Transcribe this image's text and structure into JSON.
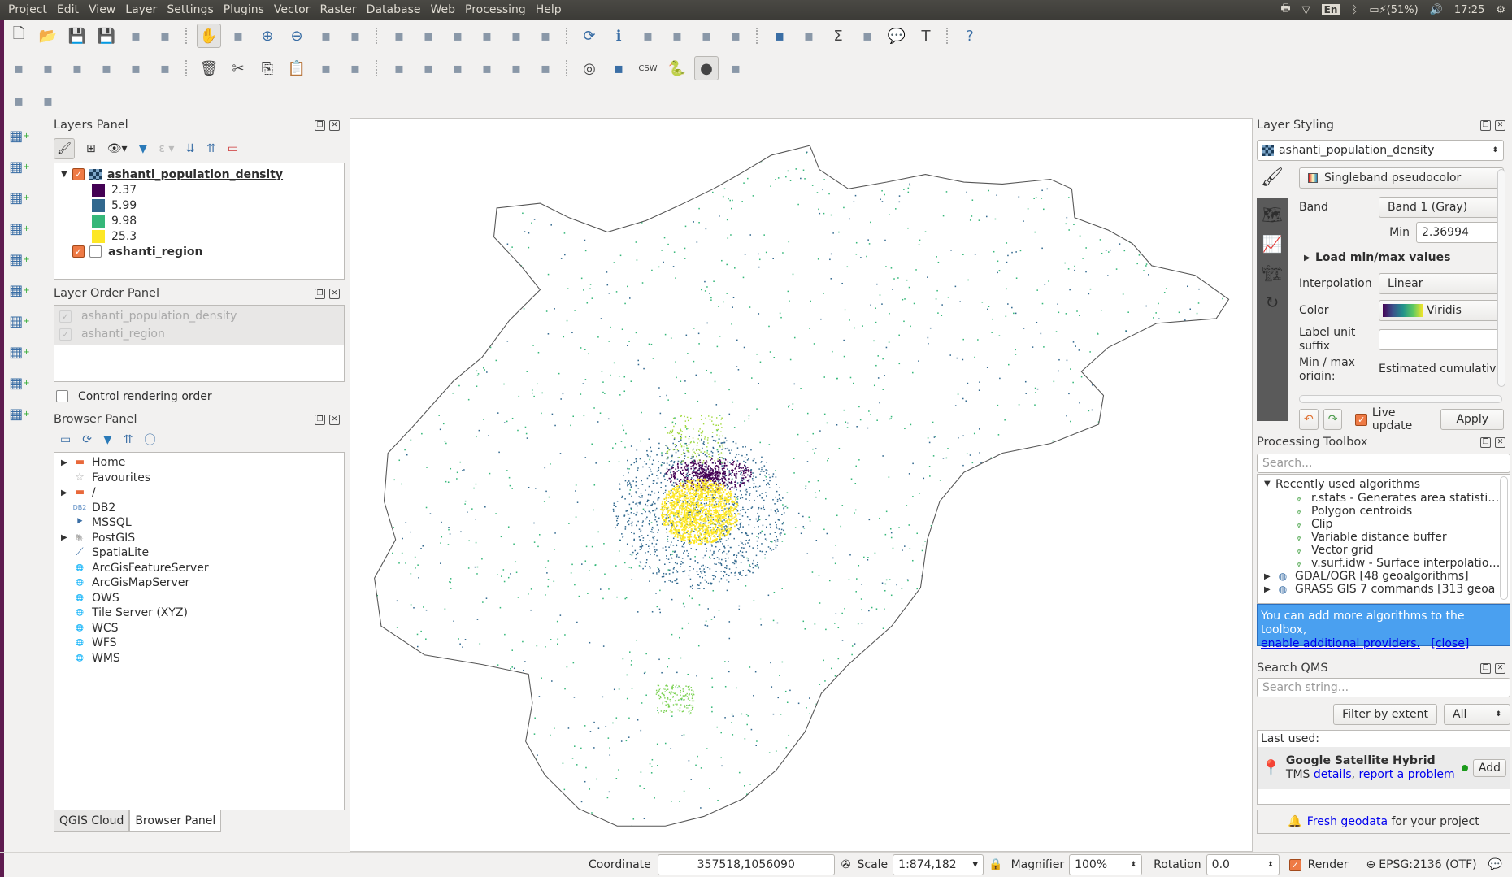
{
  "menubar": {
    "items": [
      "Project",
      "Edit",
      "View",
      "Layer",
      "Settings",
      "Plugins",
      "Vector",
      "Raster",
      "Database",
      "Web",
      "Processing",
      "Help"
    ],
    "tray": {
      "language": "En",
      "battery": "(51%)",
      "time": "17:25"
    }
  },
  "toolbars": {
    "row1": [
      "new-project",
      "open-project",
      "save-project",
      "save-as",
      "new-print-composer",
      "composer-manager",
      "pan",
      "pan-to-selection",
      "zoom-in",
      "zoom-out",
      "zoom-native",
      "zoom-full",
      "zoom-to-selection",
      "zoom-to-layer",
      "zoom-last",
      "zoom-next",
      "new-bookmark",
      "show-bookmarks",
      "refresh",
      "identify",
      "run-action",
      "select-features",
      "select-by-expression",
      "deselect",
      "open-attribute-table",
      "field-calculator",
      "statistical-summary",
      "measure",
      "map-tips",
      "text-annotation",
      "help"
    ],
    "row2": [
      "digitize",
      "toggle-editing",
      "save-edits",
      "add-feature",
      "vertex-tool",
      "move-feature",
      "delete-selected",
      "cut-features",
      "copy-features",
      "paste-features",
      "layer-labeling",
      "label-diagram",
      "pin-labels",
      "highlight-labels",
      "move-label",
      "rotate-label",
      "change-label",
      "label-properties",
      "offline-edit",
      "metasearch",
      "csw",
      "python-console",
      "qgis-cloud",
      "qms-plugin"
    ],
    "row3": [
      "select-tool",
      "geo-plugin"
    ]
  },
  "vertical_toolbar": [
    "add-vector-layer",
    "add-raster-layer",
    "add-spatialite-layer",
    "add-postgis-layer",
    "add-wms-layer",
    "add-wcs-layer",
    "add-wfs-layer",
    "add-delimited-text-layer",
    "new-shapefile-layer",
    "add-virtual-layer"
  ],
  "layers_panel": {
    "title": "Layers Panel",
    "layers": [
      {
        "name": "ashanti_population_density",
        "checked": true,
        "legend": [
          {
            "label": "2.37",
            "color": "#440154"
          },
          {
            "label": "5.99",
            "color": "#31688e"
          },
          {
            "label": "9.98",
            "color": "#35b779"
          },
          {
            "label": "25.3",
            "color": "#fde725"
          }
        ]
      },
      {
        "name": "ashanti_region",
        "checked": true
      }
    ]
  },
  "layer_order_panel": {
    "title": "Layer Order Panel",
    "items": [
      "ashanti_population_density",
      "ashanti_region"
    ],
    "control_label": "Control rendering order",
    "control_checked": false
  },
  "browser_panel": {
    "title": "Browser Panel",
    "items": [
      {
        "label": "Home",
        "icon": "folder-icon",
        "expandable": true
      },
      {
        "label": "Favourites",
        "icon": "star-icon",
        "expandable": false
      },
      {
        "label": "/",
        "icon": "folder-icon",
        "expandable": true
      },
      {
        "label": "DB2",
        "icon": "db2-icon",
        "expandable": false
      },
      {
        "label": "MSSQL",
        "icon": "mssql-icon",
        "expandable": false
      },
      {
        "label": "PostGIS",
        "icon": "postgis-icon",
        "expandable": true
      },
      {
        "label": "SpatiaLite",
        "icon": "feather-icon",
        "expandable": false
      },
      {
        "label": "ArcGisFeatureServer",
        "icon": "globe-icon",
        "expandable": false
      },
      {
        "label": "ArcGisMapServer",
        "icon": "globe-icon",
        "expandable": false
      },
      {
        "label": "OWS",
        "icon": "globe-icon",
        "expandable": false
      },
      {
        "label": "Tile Server (XYZ)",
        "icon": "globe-icon",
        "expandable": false
      },
      {
        "label": "WCS",
        "icon": "globe-icon",
        "expandable": false
      },
      {
        "label": "WFS",
        "icon": "globe-icon",
        "expandable": false
      },
      {
        "label": "WMS",
        "icon": "globe-icon",
        "expandable": false
      }
    ],
    "tabs": [
      "QGIS Cloud",
      "Browser Panel"
    ],
    "active_tab": "Browser Panel"
  },
  "layer_styling": {
    "title": "Layer Styling",
    "layer": "ashanti_population_density",
    "renderer": "Singleband pseudocolor",
    "band_label": "Band",
    "band": "Band 1 (Gray)",
    "min_label": "Min",
    "min": "2.36994",
    "load_minmax": "Load min/max values",
    "interpolation_label": "Interpolation",
    "interpolation": "Linear",
    "color_label": "Color",
    "color_ramp": "Viridis",
    "unit_label": "Label unit suffix",
    "unit_value": "",
    "origin_label": "Min / max origin:",
    "origin_value": "Estimated cumulative",
    "live_update": "Live update",
    "live_checked": true,
    "apply": "Apply"
  },
  "processing_toolbox": {
    "title": "Processing Toolbox",
    "search_placeholder": "Search...",
    "recent_label": "Recently used algorithms",
    "recent": [
      "r.stats - Generates area statisti…",
      "Polygon centroids",
      "Clip",
      "Variable distance buffer",
      "Vector grid",
      "v.surf.idw - Surface interpolatio…"
    ],
    "groups": [
      "GDAL/OGR [48 geoalgorithms]",
      "GRASS GIS 7 commands [313 geoa"
    ],
    "info_text": "You can add more algorithms to the toolbox,",
    "info_link": "enable additional providers.",
    "info_close": "[close]"
  },
  "search_qms": {
    "title": "Search QMS",
    "search_placeholder": "Search string...",
    "filter_button": "Filter by extent",
    "filter_value": "All",
    "last_used": "Last used:",
    "service_name": "Google Satellite Hybrid",
    "service_type": "TMS",
    "details_link": "details",
    "report_link": "report a problem",
    "add_button": "Add",
    "fresh_link": "Fresh geodata",
    "fresh_text": "for your project"
  },
  "statusbar": {
    "coordinate_label": "Coordinate",
    "coordinate": "357518,1056090",
    "scale_label": "Scale",
    "scale": "1:874,182",
    "magnifier_label": "Magnifier",
    "magnifier": "100%",
    "rotation_label": "Rotation",
    "rotation": "0.0",
    "render_label": "Render",
    "render_checked": true,
    "crs": "EPSG:2136 (OTF)"
  },
  "map": {
    "background": "#ffffff",
    "outline_color": "#555555"
  }
}
